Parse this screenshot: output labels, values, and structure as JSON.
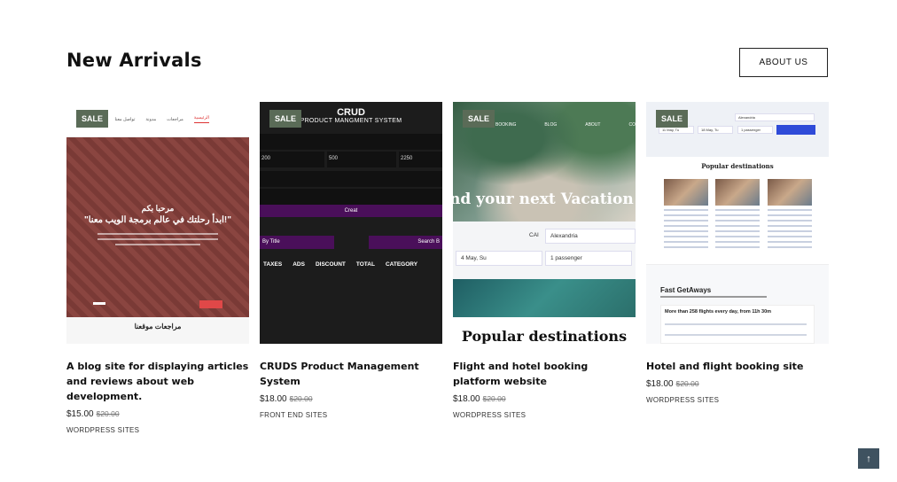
{
  "section": {
    "title": "New Arrivals",
    "about_label": "ABOUT US"
  },
  "products": [
    {
      "badge": "SALE",
      "title": "A blog site for displaying articles and reviews about web development.",
      "price": "$15.00",
      "old_price": "$20.00",
      "category": "WORDPRESS SITES",
      "thumb": {
        "nav": [
          "الرئيسية",
          "مراجعات",
          "مدونة",
          "تواصل معنا"
        ],
        "hero_line1": "مرحبا بكم",
        "hero_line2": "\"ابدأ رحلتك في عالم برمجة الويب معنا!\"",
        "footer": "مراجعات موقعنا"
      }
    },
    {
      "badge": "SALE",
      "title": "CRUDS Product Management System",
      "price": "$18.00",
      "old_price": "$20.00",
      "category": "FRONT END SITES",
      "thumb": {
        "heading": "CRUD",
        "subheading": "PRODUCT MANGMENT SYSTEM",
        "inputs": [
          "200",
          "500",
          "2250"
        ],
        "create": "Creat",
        "search_title": "By Title",
        "search_btn": "Search B",
        "columns": [
          "TAXES",
          "ADS",
          "DISCOUNT",
          "TOTAL",
          "CATEGORY"
        ]
      }
    },
    {
      "badge": "SALE",
      "title": "Flight and hotel booking platform website",
      "price": "$18.00",
      "old_price": "$20.00",
      "category": "WORDPRESS SITES",
      "thumb": {
        "nav": [
          "BOOKING",
          "BLOG",
          "ABOUT",
          "CO"
        ],
        "headline": "nd your next Vacation st",
        "from_code": "CAI",
        "to": "Alexandria",
        "date": "4 May, Su",
        "passengers": "1 passenger",
        "section": "Popular destinations"
      }
    },
    {
      "badge": "SALE",
      "title": "Hotel and flight booking site",
      "price": "$18.00",
      "old_price": "$20.00",
      "category": "WORDPRESS SITES",
      "thumb": {
        "section": "Popular destinations",
        "getaway_title": "Fast GetAways",
        "flights_text": "More than 258 flights every day, from 11h 30m",
        "date_a": "11 May, Tu",
        "date_b": "18 May, Tu",
        "city": "Alexandria",
        "passengers": "1 passenger"
      }
    }
  ],
  "back_to_top": "↑"
}
